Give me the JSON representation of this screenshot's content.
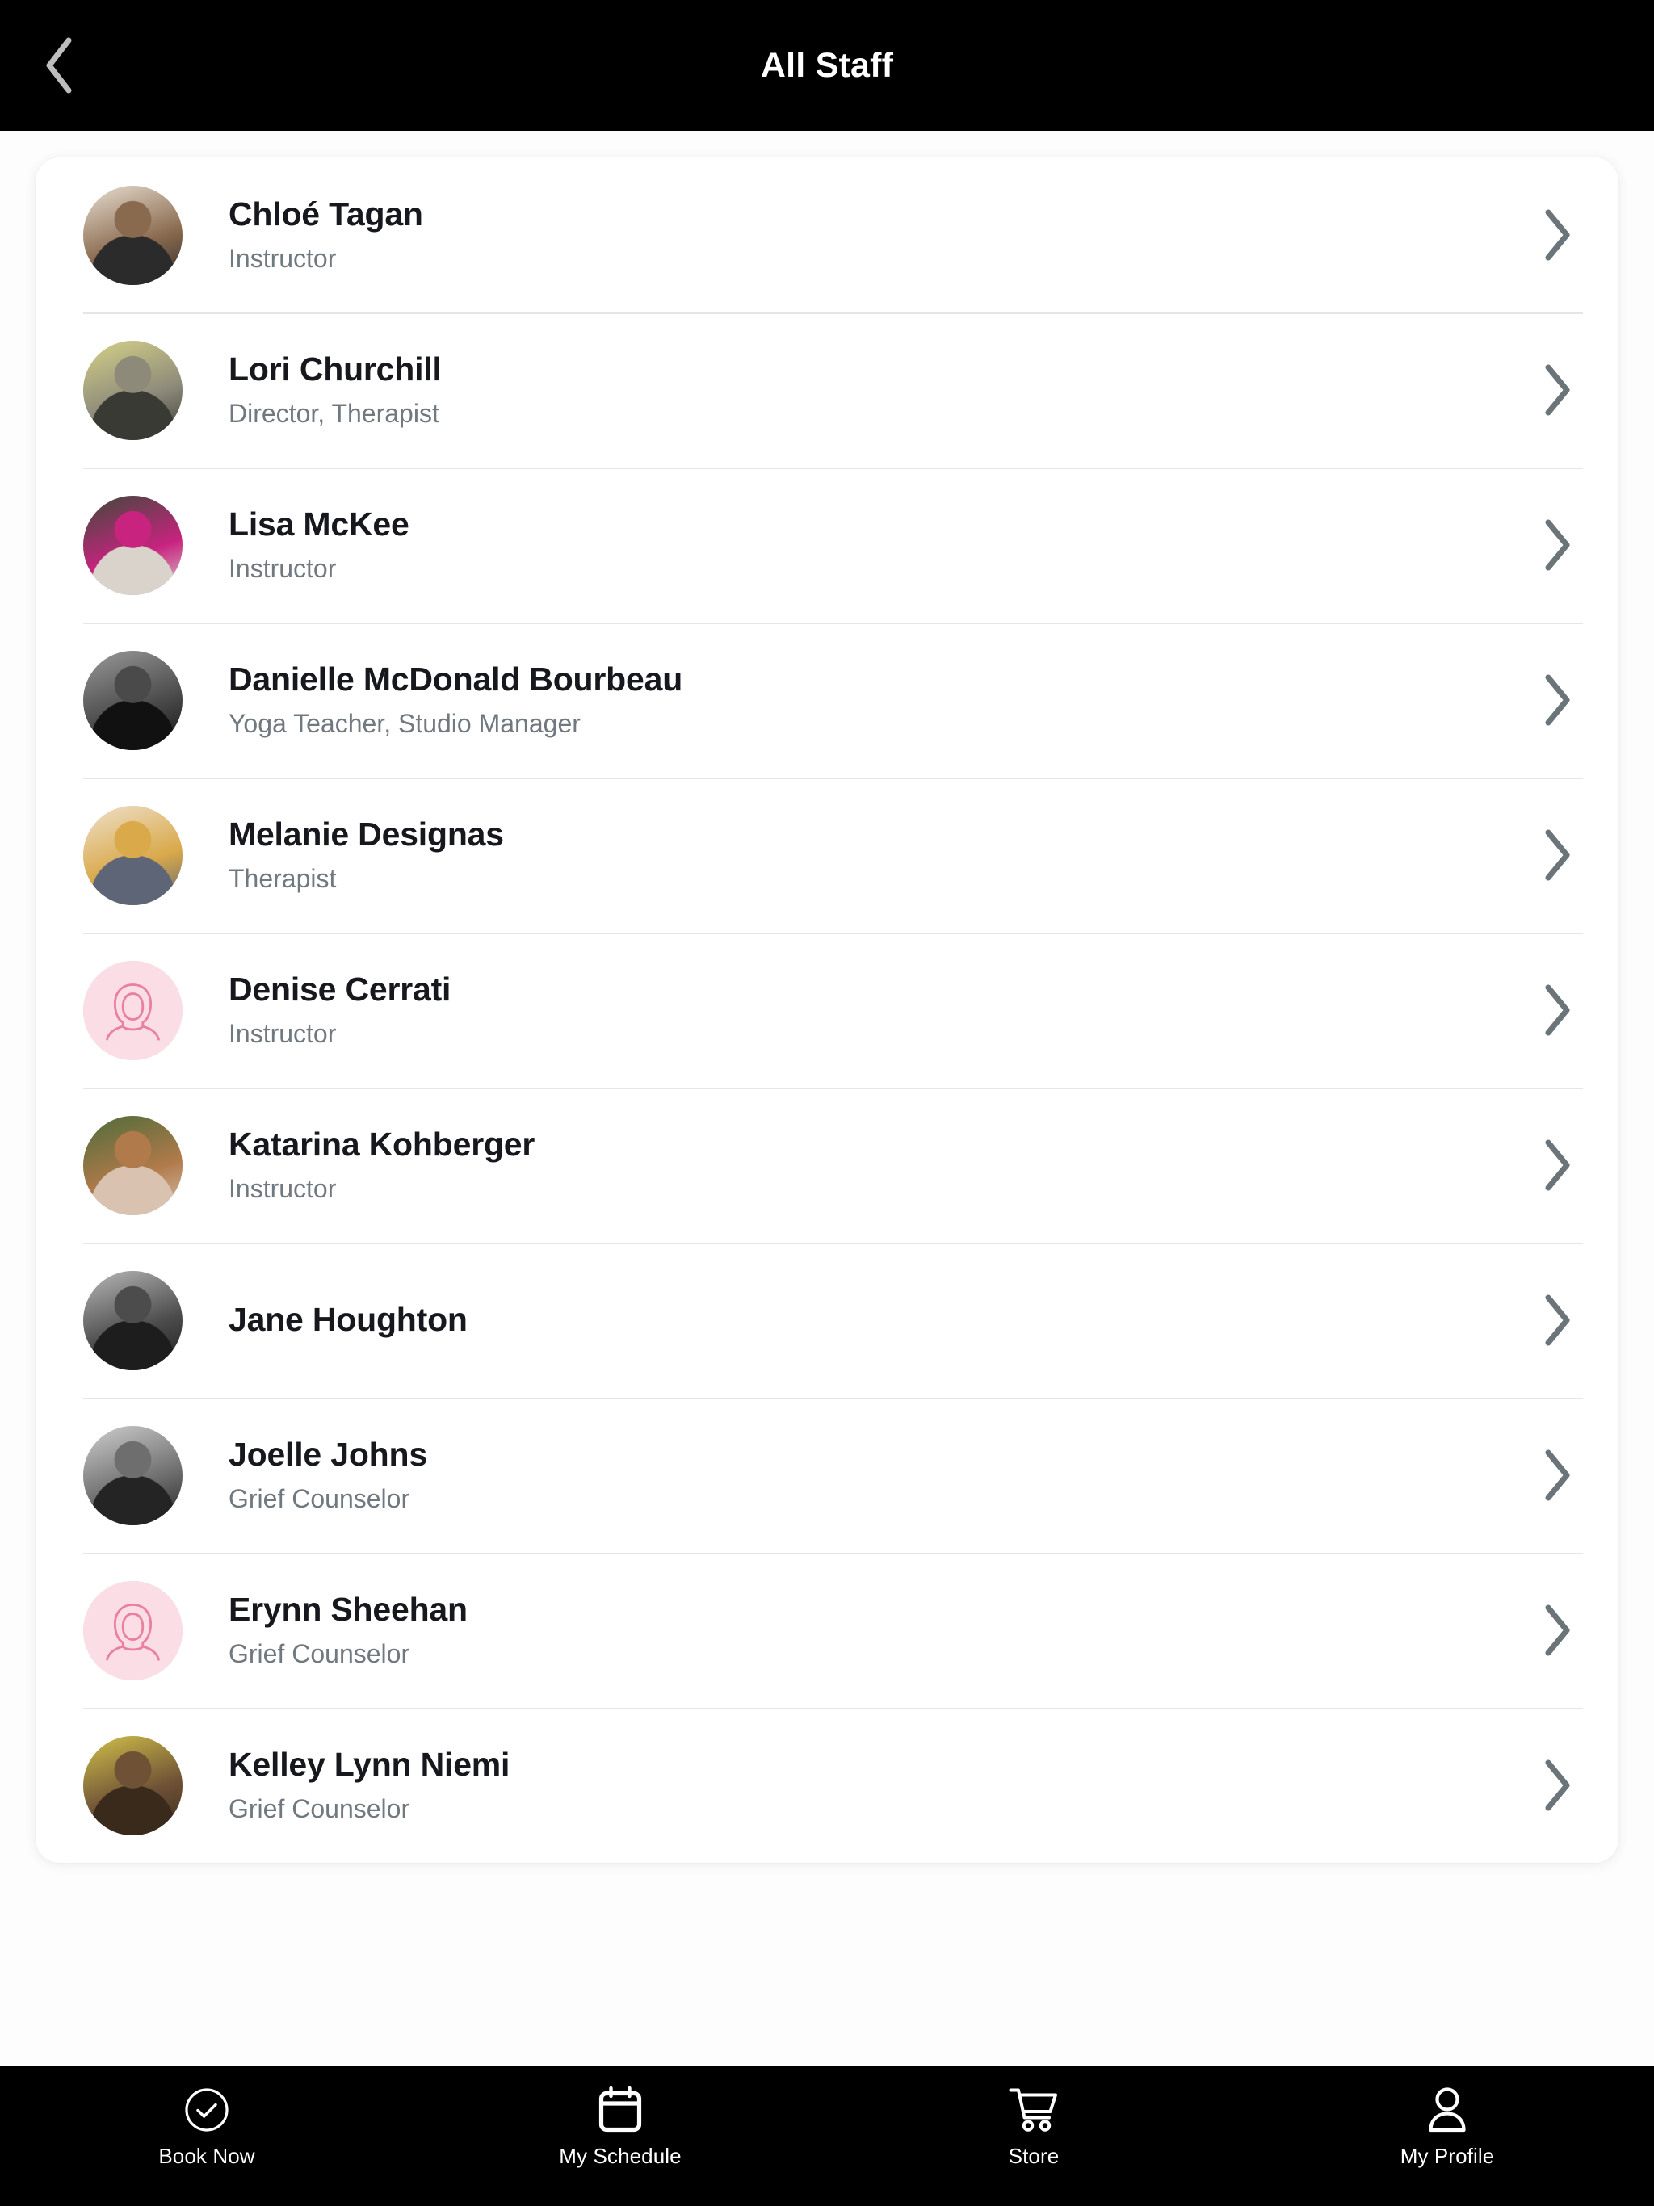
{
  "header": {
    "title": "All Staff",
    "back_icon": "chevron-left-icon",
    "background_color": "#000000",
    "title_color": "#ffffff"
  },
  "colors": {
    "page_background": "#fdfdfd",
    "card_background": "#ffffff",
    "name_text": "#16181d",
    "role_text": "#70797f",
    "divider": "#e6e6e8",
    "chevron": "#6b7478",
    "placeholder_avatar_bg": "#fbdde5",
    "placeholder_avatar_stroke": "#e9809d",
    "tabbar_background": "#000000",
    "tabbar_text": "#ffffff"
  },
  "staff": [
    {
      "name": "Chloé Tagan",
      "role": "Instructor",
      "avatar_type": "photo",
      "avatar_name": "avatar-chloe-tagan",
      "avatar_colors": [
        "#e8dfd2",
        "#8a6a4f",
        "#2b2b2b"
      ]
    },
    {
      "name": "Lori Churchill",
      "role": "Director, Therapist",
      "avatar_type": "photo",
      "avatar_name": "avatar-lori-churchill",
      "avatar_colors": [
        "#d6d289",
        "#8d8a7a",
        "#3a3a35"
      ]
    },
    {
      "name": "Lisa McKee",
      "role": "Instructor",
      "avatar_type": "photo",
      "avatar_name": "avatar-lisa-mckee",
      "avatar_colors": [
        "#3f4a3a",
        "#c7237f",
        "#d9d3cb"
      ]
    },
    {
      "name": "Danielle McDonald Bourbeau",
      "role": "Yoga Teacher, Studio Manager",
      "avatar_type": "photo",
      "avatar_name": "avatar-danielle-mcdonald-bourbeau",
      "avatar_colors": [
        "#9a9a9a",
        "#4a4a4a",
        "#111111"
      ]
    },
    {
      "name": "Melanie Designas",
      "role": "Therapist",
      "avatar_type": "photo",
      "avatar_name": "avatar-melanie-designas",
      "avatar_colors": [
        "#efe0cb",
        "#d9a94a",
        "#5d6576"
      ]
    },
    {
      "name": "Denise Cerrati",
      "role": "Instructor",
      "avatar_type": "placeholder",
      "avatar_name": "avatar-placeholder-denise-cerrati",
      "avatar_colors": [
        "#fbdde5",
        "#e9809d"
      ]
    },
    {
      "name": "Katarina Kohberger",
      "role": "Instructor",
      "avatar_type": "photo",
      "avatar_name": "avatar-katarina-kohberger",
      "avatar_colors": [
        "#4e6b3a",
        "#b07a4a",
        "#d9c3b0"
      ]
    },
    {
      "name": "Jane Houghton",
      "role": "",
      "avatar_type": "photo",
      "avatar_name": "avatar-jane-houghton",
      "avatar_colors": [
        "#b9b9b9",
        "#4c4c4c",
        "#1d1d1d"
      ]
    },
    {
      "name": "Joelle Johns",
      "role": "Grief Counselor",
      "avatar_type": "photo",
      "avatar_name": "avatar-joelle-johns",
      "avatar_colors": [
        "#cfcfcf",
        "#6e6e6e",
        "#242424"
      ]
    },
    {
      "name": "Erynn Sheehan",
      "role": "Grief Counselor",
      "avatar_type": "placeholder",
      "avatar_name": "avatar-placeholder-erynn-sheehan",
      "avatar_colors": [
        "#fbdde5",
        "#e9809d"
      ]
    },
    {
      "name": "Kelley Lynn Niemi",
      "role": "Grief Counselor",
      "avatar_type": "photo",
      "avatar_name": "avatar-kelley-lynn-niemi",
      "avatar_colors": [
        "#d2c14a",
        "#6f5236",
        "#3a2a1c"
      ]
    }
  ],
  "row_chevron_icon": "chevron-right-icon",
  "tabbar": {
    "items": [
      {
        "label": "Book Now",
        "icon": "check-circle-icon"
      },
      {
        "label": "My Schedule",
        "icon": "calendar-icon"
      },
      {
        "label": "Store",
        "icon": "shopping-cart-icon"
      },
      {
        "label": "My Profile",
        "icon": "person-icon"
      }
    ]
  }
}
